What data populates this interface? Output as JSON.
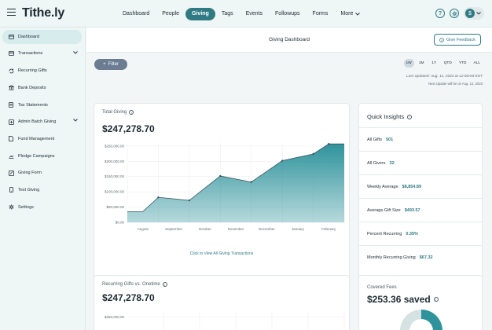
{
  "app": {
    "logo": "Tithe.ly"
  },
  "nav": {
    "items": [
      {
        "label": "Dashboard",
        "active": false
      },
      {
        "label": "People",
        "active": false
      },
      {
        "label": "Giving",
        "active": true
      },
      {
        "label": "Tags",
        "active": false
      },
      {
        "label": "Events",
        "active": false
      },
      {
        "label": "Followups",
        "active": false
      },
      {
        "label": "Forms",
        "active": false
      }
    ],
    "more_label": "More",
    "top_icons": [
      "help-icon",
      "settings-icon",
      "avatar"
    ]
  },
  "sidebar": {
    "items": [
      {
        "label": "Dashboard",
        "icon": "dashboard-icon",
        "active": true,
        "chevron": false
      },
      {
        "label": "Transactions",
        "icon": "transactions-icon",
        "active": false,
        "chevron": true
      },
      {
        "label": "Recurring Gifts",
        "icon": "recurring-icon",
        "active": false,
        "chevron": false
      },
      {
        "label": "Bank Deposits",
        "icon": "bank-icon",
        "active": false,
        "chevron": false
      },
      {
        "label": "Tax Statements",
        "icon": "tax-icon",
        "active": false,
        "chevron": false
      },
      {
        "label": "Admin Batch Giving",
        "icon": "batch-icon",
        "active": false,
        "chevron": true
      },
      {
        "label": "Fund Management",
        "icon": "fund-icon",
        "active": false,
        "chevron": false
      },
      {
        "label": "Pledge Campaigns",
        "icon": "pledge-icon",
        "active": false,
        "chevron": false
      },
      {
        "label": "Giving Form",
        "icon": "form-icon",
        "active": false,
        "chevron": false
      },
      {
        "label": "Text Giving",
        "icon": "text-icon",
        "active": false,
        "chevron": false
      },
      {
        "label": "Settings",
        "icon": "gear-icon",
        "active": false,
        "chevron": false
      }
    ]
  },
  "header": {
    "title": "Giving Dashboard",
    "feedback_label": "Give Feedback"
  },
  "filters": {
    "filter_label": "Filter",
    "ranges": [
      "1W",
      "1M",
      "1Y",
      "QTD",
      "YTD",
      "ALL"
    ],
    "active_range": "1W",
    "last_updated": "Last Updated: Aug. 11, 2023 at 12:00AM EST",
    "next_update": "Next Update will be on Aug. 12, 2023"
  },
  "total_giving": {
    "label": "Total Giving",
    "amount": "$247,278.70",
    "link": "Click to View All Giving Transactions"
  },
  "chart_data": {
    "type": "area",
    "categories": [
      "August",
      "September",
      "October",
      "November",
      "December",
      "January",
      "February"
    ],
    "x": [
      0.5,
      1,
      2,
      3,
      4,
      5,
      6,
      6.5
    ],
    "values": [
      35000,
      82000,
      72000,
      152000,
      132000,
      202000,
      224000,
      257000
    ],
    "yticks": [
      "$250,000.00",
      "$200,000.00",
      "$150,000.00",
      "$100,000.00",
      "$50,000.00",
      "$0.00"
    ],
    "ylim": [
      0,
      260000
    ],
    "grid": true,
    "color": "#2f939c"
  },
  "quick_insights": {
    "title": "Quick Insights",
    "rows": [
      {
        "label": "All Gifts",
        "value": "501"
      },
      {
        "label": "All Givers",
        "value": "32"
      },
      {
        "label": "Weekly Average",
        "value": "$8,854.89"
      },
      {
        "label": "Average Gift Size",
        "value": "$493.57"
      },
      {
        "label": "Percent Recurring",
        "value": "0.35%"
      },
      {
        "label": "Monthly Recurring Giving",
        "value": "$67.32"
      }
    ]
  },
  "recurring_vs_onetime": {
    "label": "Recurring Gifts vs. Onetime",
    "amount": "$247,278.70",
    "ytick": "$250,000.00"
  },
  "covered_fees": {
    "label": "Covered Fees",
    "amount": "$253.36 saved"
  },
  "colors": {
    "accent": "#2f7a83",
    "chart_fill": "#2f939c"
  }
}
